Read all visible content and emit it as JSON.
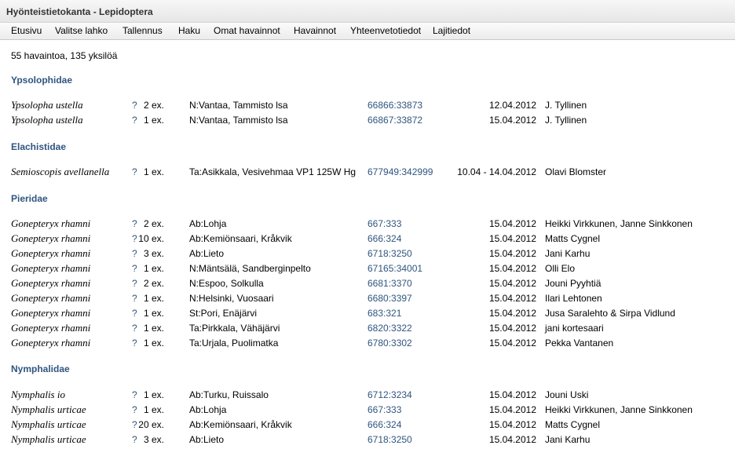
{
  "window": {
    "title": "Hyönteistietokanta - Lepidoptera"
  },
  "menu": [
    "Etusivu",
    "Valitse lahko",
    "Tallennus",
    "Haku",
    "Omat havainnot",
    "Havainnot",
    "Yhteenvetotiedot",
    "Lajitiedot"
  ],
  "summary": "55 havaintoa, 135 yksilöä",
  "groups": [
    {
      "family": "Ypsolophidae",
      "rows": [
        {
          "species": "Ypsolopha ustella",
          "q": "?",
          "count": "2 ex.",
          "location": "N:Vantaa, Tammisto lsa",
          "coord": "66866:33873",
          "date": "12.04.2012",
          "observer": "J. Tyllinen"
        },
        {
          "species": "Ypsolopha ustella",
          "q": "?",
          "count": "1 ex.",
          "location": "N:Vantaa, Tammisto lsa",
          "coord": "66867:33872",
          "date": "15.04.2012",
          "observer": "J. Tyllinen"
        }
      ]
    },
    {
      "family": "Elachistidae",
      "rows": [
        {
          "species": "Semioscopis avellanella",
          "q": "?",
          "count": "1 ex.",
          "location": "Ta:Asikkala, Vesivehmaa VP1 125W Hg",
          "coord": "677949:342999",
          "date": "10.04 - 14.04.2012",
          "observer": "Olavi Blomster"
        }
      ]
    },
    {
      "family": "Pieridae",
      "rows": [
        {
          "species": "Gonepteryx rhamni",
          "q": "?",
          "count": "2 ex.",
          "location": "Ab:Lohja",
          "coord": "667:333",
          "date": "15.04.2012",
          "observer": "Heikki Virkkunen, Janne Sinkkonen"
        },
        {
          "species": "Gonepteryx rhamni",
          "q": "?",
          "count": "10 ex.",
          "location": "Ab:Kemiönsaari, Kråkvik",
          "coord": "666:324",
          "date": "15.04.2012",
          "observer": "Matts Cygnel"
        },
        {
          "species": "Gonepteryx rhamni",
          "q": "?",
          "count": "3 ex.",
          "location": "Ab:Lieto",
          "coord": "6718:3250",
          "date": "15.04.2012",
          "observer": "Jani Karhu"
        },
        {
          "species": "Gonepteryx rhamni",
          "q": "?",
          "count": "1 ex.",
          "location": "N:Mäntsälä, Sandberginpelto",
          "coord": "67165:34001",
          "date": "15.04.2012",
          "observer": "Olli Elo"
        },
        {
          "species": "Gonepteryx rhamni",
          "q": "?",
          "count": "2 ex.",
          "location": "N:Espoo, Solkulla",
          "coord": "6681:3370",
          "date": "15.04.2012",
          "observer": "Jouni Pyyhtiä"
        },
        {
          "species": "Gonepteryx rhamni",
          "q": "?",
          "count": "1 ex.",
          "location": "N:Helsinki, Vuosaari",
          "coord": "6680:3397",
          "date": "15.04.2012",
          "observer": "Ilari Lehtonen"
        },
        {
          "species": "Gonepteryx rhamni",
          "q": "?",
          "count": "1 ex.",
          "location": "St:Pori, Enäjärvi",
          "coord": "683:321",
          "date": "15.04.2012",
          "observer": "Jusa Saralehto & Sirpa Vidlund"
        },
        {
          "species": "Gonepteryx rhamni",
          "q": "?",
          "count": "1 ex.",
          "location": "Ta:Pirkkala, Vähäjärvi",
          "coord": "6820:3322",
          "date": "15.04.2012",
          "observer": "jani kortesaari"
        },
        {
          "species": "Gonepteryx rhamni",
          "q": "?",
          "count": "1 ex.",
          "location": "Ta:Urjala, Puolimatka",
          "coord": "6780:3302",
          "date": "15.04.2012",
          "observer": "Pekka Vantanen"
        }
      ]
    },
    {
      "family": "Nymphalidae",
      "rows": [
        {
          "species": "Nymphalis io",
          "q": "?",
          "count": "1 ex.",
          "location": "Ab:Turku, Ruissalo",
          "coord": "6712:3234",
          "date": "15.04.2012",
          "observer": "Jouni Uski"
        },
        {
          "species": "Nymphalis urticae",
          "q": "?",
          "count": "1 ex.",
          "location": "Ab:Lohja",
          "coord": "667:333",
          "date": "15.04.2012",
          "observer": "Heikki Virkkunen, Janne Sinkkonen"
        },
        {
          "species": "Nymphalis urticae",
          "q": "?",
          "count": "20 ex.",
          "location": "Ab:Kemiönsaari, Kråkvik",
          "coord": "666:324",
          "date": "15.04.2012",
          "observer": "Matts Cygnel"
        },
        {
          "species": "Nymphalis urticae",
          "q": "?",
          "count": "3 ex.",
          "location": "Ab:Lieto",
          "coord": "6718:3250",
          "date": "15.04.2012",
          "observer": "Jani Karhu"
        }
      ]
    }
  ]
}
